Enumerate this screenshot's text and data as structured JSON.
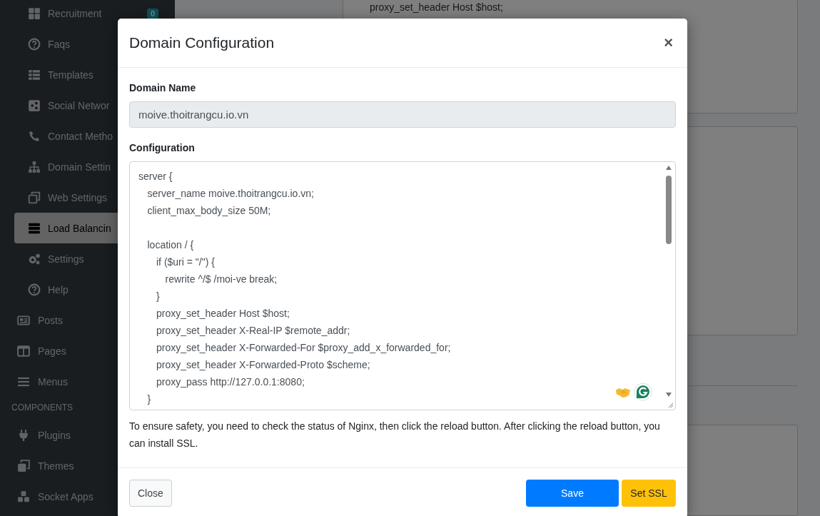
{
  "sidebar": {
    "submenu_items": [
      {
        "label": "Recruitment",
        "badge": "0",
        "selected": false
      },
      {
        "label": "Faqs",
        "selected": false
      },
      {
        "label": "Templates",
        "selected": false
      },
      {
        "label": "Social Networ",
        "selected": false
      },
      {
        "label": "Contact Metho",
        "selected": false
      },
      {
        "label": "Domain Settin",
        "selected": false
      },
      {
        "label": "Web Settings",
        "selected": false
      },
      {
        "label": "Load Balancin",
        "selected": true
      },
      {
        "label": "Settings",
        "selected": false
      },
      {
        "label": "Help",
        "selected": false
      }
    ],
    "items": [
      {
        "label": "Posts"
      },
      {
        "label": "Pages"
      },
      {
        "label": "Menus"
      }
    ],
    "components_header": "COMPONENTS",
    "component_items": [
      {
        "label": "Plugins"
      },
      {
        "label": "Themes"
      },
      {
        "label": "Socket Apps"
      }
    ]
  },
  "background_config": {
    "lines": [
      "proxy_set_header Host $host;"
    ]
  },
  "modal": {
    "title": "Domain Configuration",
    "close": "×",
    "domain_label": "Domain Name",
    "domain_value": "moive.thoitrangcu.io.vn",
    "config_label": "Configuration",
    "config_lines": [
      {
        "text": "server {",
        "children": [
          {
            "text": "server_name moive.thoitrangcu.io.vn;"
          },
          {
            "text": "client_max_body_size 50M;",
            "gap_after": true
          },
          {
            "text": "location / {",
            "children": [
              {
                "text": "if ($uri = \"/\") {",
                "children": [
                  {
                    "text": "rewrite ^/$ /moi-ve break;"
                  }
                ]
              },
              {
                "text": "}"
              },
              {
                "text": "proxy_set_header Host $host;"
              },
              {
                "text": "proxy_set_header X-Real-IP $remote_addr;"
              },
              {
                "text": "proxy_set_header X-Forwarded-For $proxy_add_x_forwarded_for;"
              },
              {
                "text": "proxy_set_header X-Forwarded-Proto $scheme;"
              },
              {
                "text": "proxy_pass http://127.0.0.1:8080;"
              }
            ]
          },
          {
            "text": "}"
          }
        ]
      }
    ],
    "help_text": "To ensure safety, you need to check the status of Nginx, then click the reload button. After clicking the reload button, you can install SSL.",
    "buttons": [
      {
        "label": "Close",
        "kind": "secondary"
      },
      {
        "label": "Save",
        "kind": "primary"
      },
      {
        "label": "Set SSL",
        "kind": "warning"
      }
    ]
  }
}
